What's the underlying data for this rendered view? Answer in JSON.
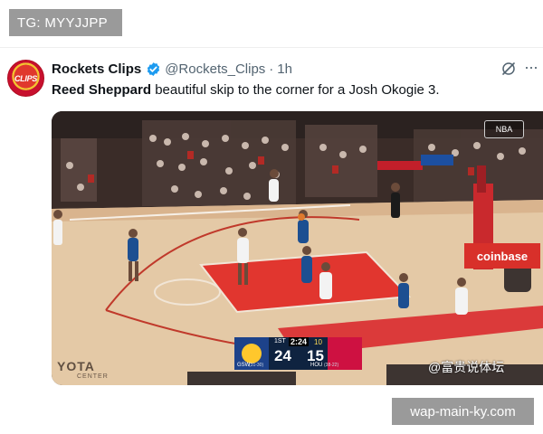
{
  "overlay": {
    "channel_tag": "TG: MYYJJPP",
    "site_label": "wap-main-ky.com"
  },
  "tweet": {
    "avatar_text": "CLIPS",
    "display_name": "Rockets Clips",
    "handle": "@Rockets_Clips",
    "separator": "·",
    "time": "1h",
    "mention": "Reed Sheppard",
    "body": " beautiful skip to the corner for a Josh Okogie 3.",
    "icons": {
      "verified": "verified-badge-icon",
      "grok": "grok-icon",
      "more": "more-options-icon"
    },
    "colors": {
      "verified": "#1d9bf0",
      "secondary_text": "#536471"
    }
  },
  "video": {
    "scorebug": {
      "quarter": "1ST",
      "clock": "2:24",
      "shot_clock": "10",
      "away_team": "GSW",
      "away_record": "(31-30)",
      "away_score": "24",
      "home_team": "HOU",
      "home_record": "(38-22)",
      "home_score": "15"
    },
    "watermark": "@富贵说体坛",
    "court_sponsor": "YOTA",
    "court_sponsor_sub": "CENTER",
    "bench_sign": "coinbase",
    "network_logo": "NBA"
  }
}
